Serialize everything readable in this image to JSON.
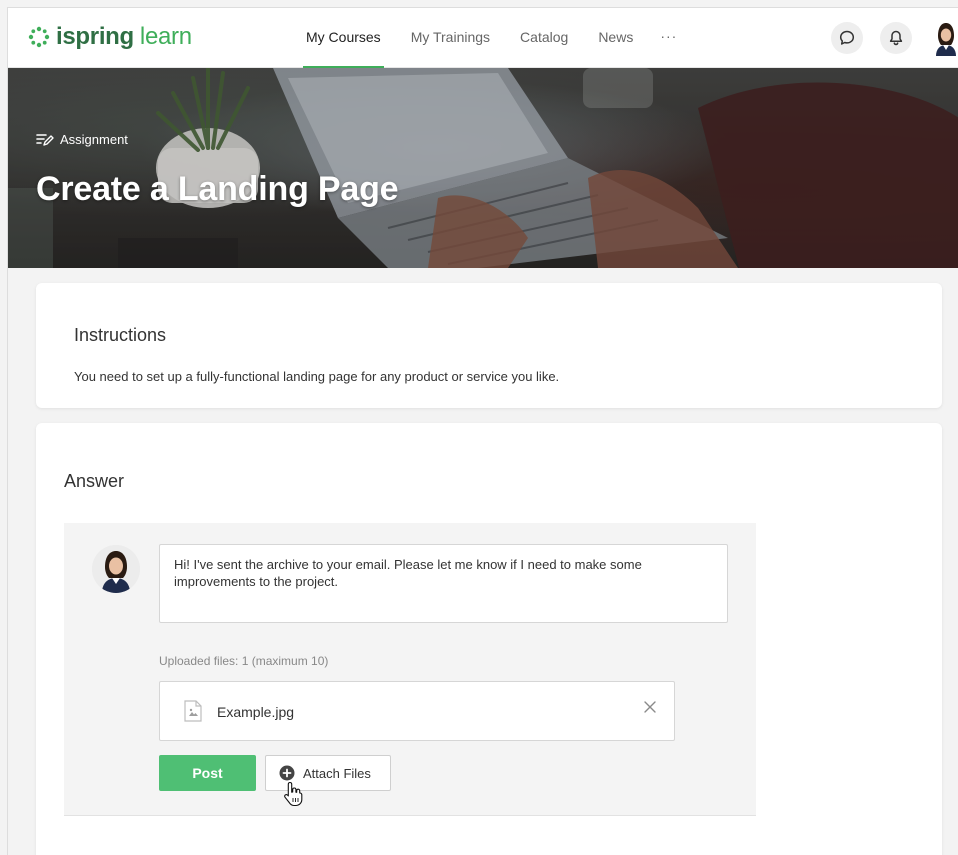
{
  "brand": {
    "word1": "ispring",
    "word2": "learn",
    "accent": "#3fae5a",
    "dark": "#2f6f44"
  },
  "nav": {
    "items": [
      {
        "label": "My Courses",
        "active": true
      },
      {
        "label": "My Trainings",
        "active": false
      },
      {
        "label": "Catalog",
        "active": false
      },
      {
        "label": "News",
        "active": false
      }
    ],
    "more_label": "···"
  },
  "header_icons": [
    "chat-icon",
    "bell-icon",
    "user-avatar"
  ],
  "hero": {
    "tag": "Assignment",
    "title": "Create a Landing Page"
  },
  "instructions": {
    "title": "Instructions",
    "text": "You need to set up a fully-functional landing page for any product or service you like."
  },
  "answer": {
    "title": "Answer",
    "message": "Hi! I've sent the archive to your email. Please let me know if I need to make some improvements to the project.",
    "uploaded_label": "Uploaded files: 1 (maximum 10)",
    "files": [
      {
        "name": "Example.jpg",
        "icon": "image-file-icon"
      }
    ],
    "post_label": "Post",
    "attach_label": "Attach Files"
  }
}
